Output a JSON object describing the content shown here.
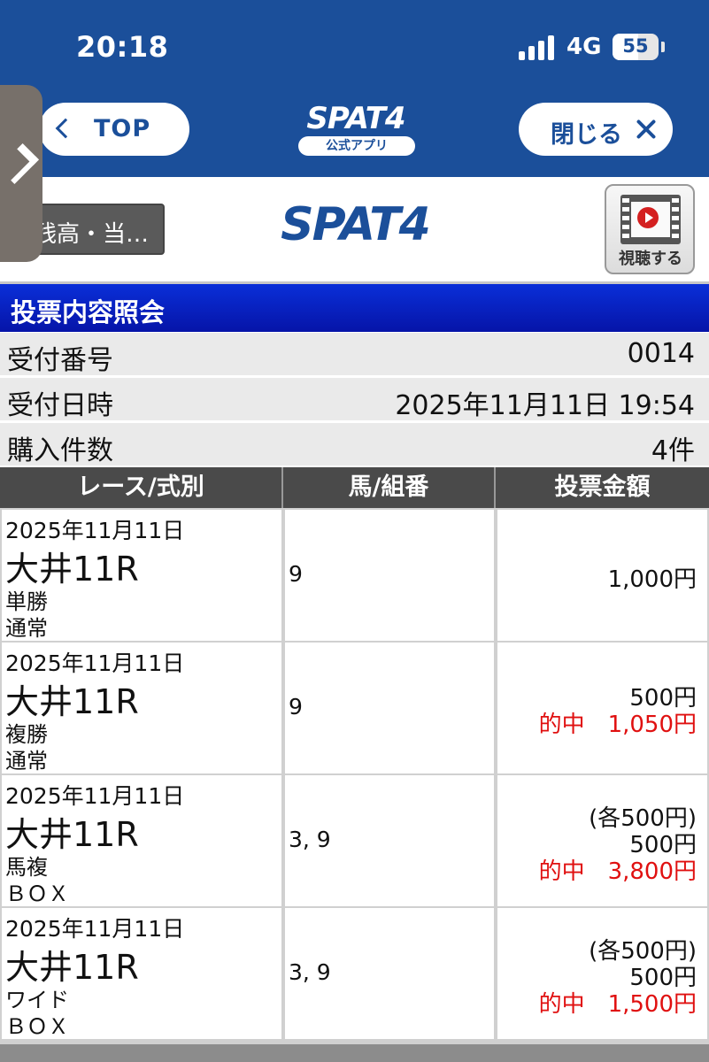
{
  "status_bar": {
    "time": "20:18",
    "network": "4G",
    "battery": "55",
    "battery_level": 0.55
  },
  "nav": {
    "back_label": "TOP",
    "close_label": "閉じる",
    "logo_word": "SPAT4",
    "logo_sub": "公式アプリ"
  },
  "header": {
    "balance_button": "残高・当…",
    "brand": "SPAT4",
    "watch_label": "視聴する"
  },
  "section_title": "投票内容照会",
  "summary": [
    {
      "label": "受付番号",
      "value": "0014"
    },
    {
      "label": "受付日時",
      "value": "2025年11月11日 19:54"
    },
    {
      "label": "購入件数",
      "value": "4件"
    }
  ],
  "table": {
    "headers": [
      "レース/式別",
      "馬/組番",
      "投票金額"
    ],
    "rows": [
      {
        "date": "2025年11月11日",
        "race": "大井11R",
        "type": "単勝",
        "method": "通常",
        "horses": "9",
        "each": "",
        "amount": "1,000円",
        "hit": ""
      },
      {
        "date": "2025年11月11日",
        "race": "大井11R",
        "type": "複勝",
        "method": "通常",
        "horses": "9",
        "each": "",
        "amount": "500円",
        "hit": "的中　1,050円"
      },
      {
        "date": "2025年11月11日",
        "race": "大井11R",
        "type": "馬複",
        "method": "ＢＯＸ",
        "horses": "3, 9",
        "each": "(各500円)",
        "amount": "500円",
        "hit": "的中　3,800円"
      },
      {
        "date": "2025年11月11日",
        "race": "大井11R",
        "type": "ワイド",
        "method": "ＢＯＸ",
        "horses": "3, 9",
        "each": "(各500円)",
        "amount": "500円",
        "hit": "的中　1,500円"
      }
    ]
  },
  "colors": {
    "nav_blue": "#1b4f9a",
    "section_blue": "#0a2fd8",
    "hit_red": "#e01010",
    "table_header": "#4a4a4a"
  }
}
